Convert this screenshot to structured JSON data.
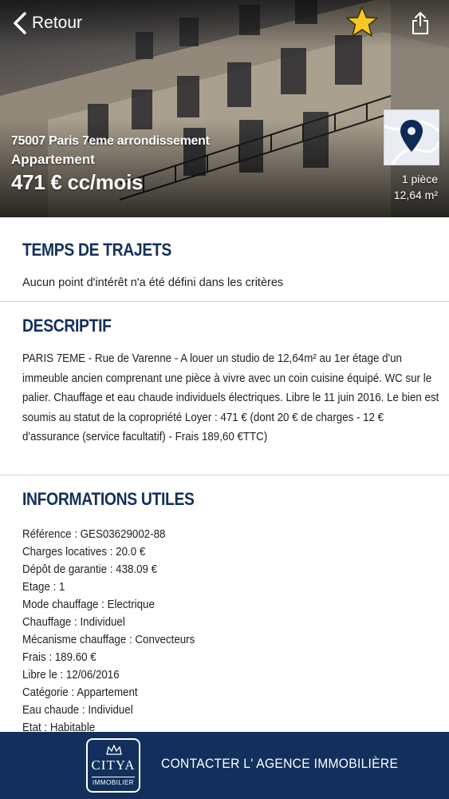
{
  "header": {
    "back_label": "Retour",
    "address_line": "75007 Paris 7eme arrondissement",
    "property_type": "Appartement",
    "price": "471 € cc/mois",
    "rooms": "1 pièce",
    "surface": "12,64 m²"
  },
  "icons": {
    "back": "chevron-left-icon",
    "favorite": "star-icon",
    "share": "share-icon",
    "map": "map-pin-icon"
  },
  "colors": {
    "accent": "#13305c",
    "favorite": "#f7c824"
  },
  "trajets": {
    "title": "TEMPS DE TRAJETS",
    "text": "Aucun point d'intérêt n'a été défini dans les critères"
  },
  "descriptif": {
    "title": "DESCRIPTIF",
    "text": "PARIS 7EME - Rue de Varenne - A louer un studio de 12,64m² au 1er étage d'un immeuble ancien comprenant une pièce à vivre avec un coin cuisine équipé. WC sur le palier. Chauffage et eau chaude individuels électriques. Libre le 11 juin 2016. Le bien est soumis au statut de la copropriété Loyer : 471 € (dont 20 € de charges - 12 € d'assurance (service facultatif) - Frais 189,60 €TTC)"
  },
  "infos": {
    "title": "INFORMATIONS UTILES",
    "items": [
      "Référence : GES03629002-88",
      "Charges locatives : 20.0 €",
      "Dépôt de garantie : 438.09 €",
      "Etage : 1",
      "Mode chauffage : Electrique",
      "Chauffage : Individuel",
      "Mécanisme chauffage : Convecteurs",
      "Frais : 189.60 €",
      "Libre le : 12/06/2016",
      "Catégorie : Appartement",
      "Eau chaude : Individuel",
      "Etat : Habitable"
    ]
  },
  "footer": {
    "logo_brand": "CITYA",
    "logo_sub": "IMMOBILIER",
    "contact_label": "CONTACTER L' AGENCE IMMOBILIÈRE"
  }
}
